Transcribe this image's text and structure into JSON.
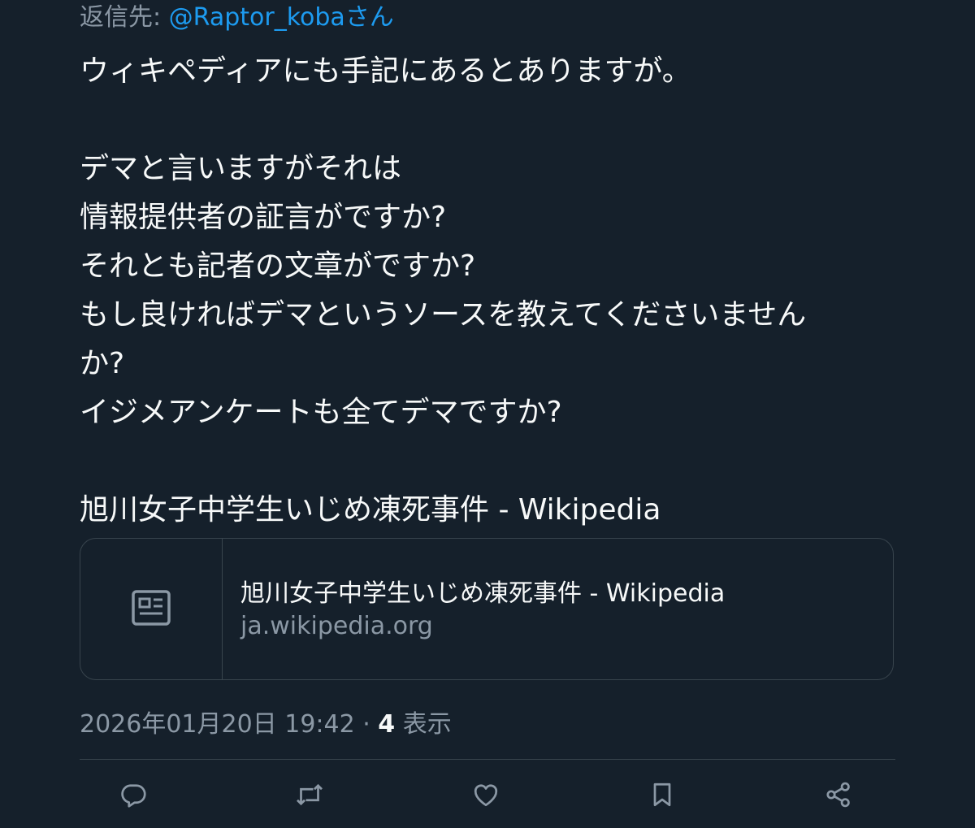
{
  "reply_to": {
    "prefix": "返信先: ",
    "handle": "@Raptor_koba",
    "suffix": "さん"
  },
  "tweet": {
    "lines": [
      "ウィキペディアにも手記にあるとありますが。",
      "",
      "デマと言いますがそれは",
      "情報提供者の証言がですか?",
      "それとも記者の文章がですか?",
      "もし良ければデマというソースを教えてくださいません",
      "か?",
      "イジメアンケートも全てデマですか?",
      "",
      "旭川女子中学生いじめ凍死事件 - Wikipedia"
    ]
  },
  "link_card": {
    "icon": "article-icon",
    "title": "旭川女子中学生いじめ凍死事件 - Wikipedia",
    "domain": "ja.wikipedia.org"
  },
  "meta": {
    "timestamp": "2026年01月20日 19:42",
    "separator": " · ",
    "views_count": "4",
    "views_label": " 表示"
  },
  "actions": [
    {
      "icon": "reply-icon"
    },
    {
      "icon": "retweet-icon"
    },
    {
      "icon": "like-icon"
    },
    {
      "icon": "bookmark-icon"
    },
    {
      "icon": "share-icon"
    }
  ],
  "colors": {
    "background": "#15202b",
    "text": "#f7f9f9",
    "secondary": "#8b98a5",
    "accent": "#1d9bf0",
    "border": "#38444d"
  }
}
